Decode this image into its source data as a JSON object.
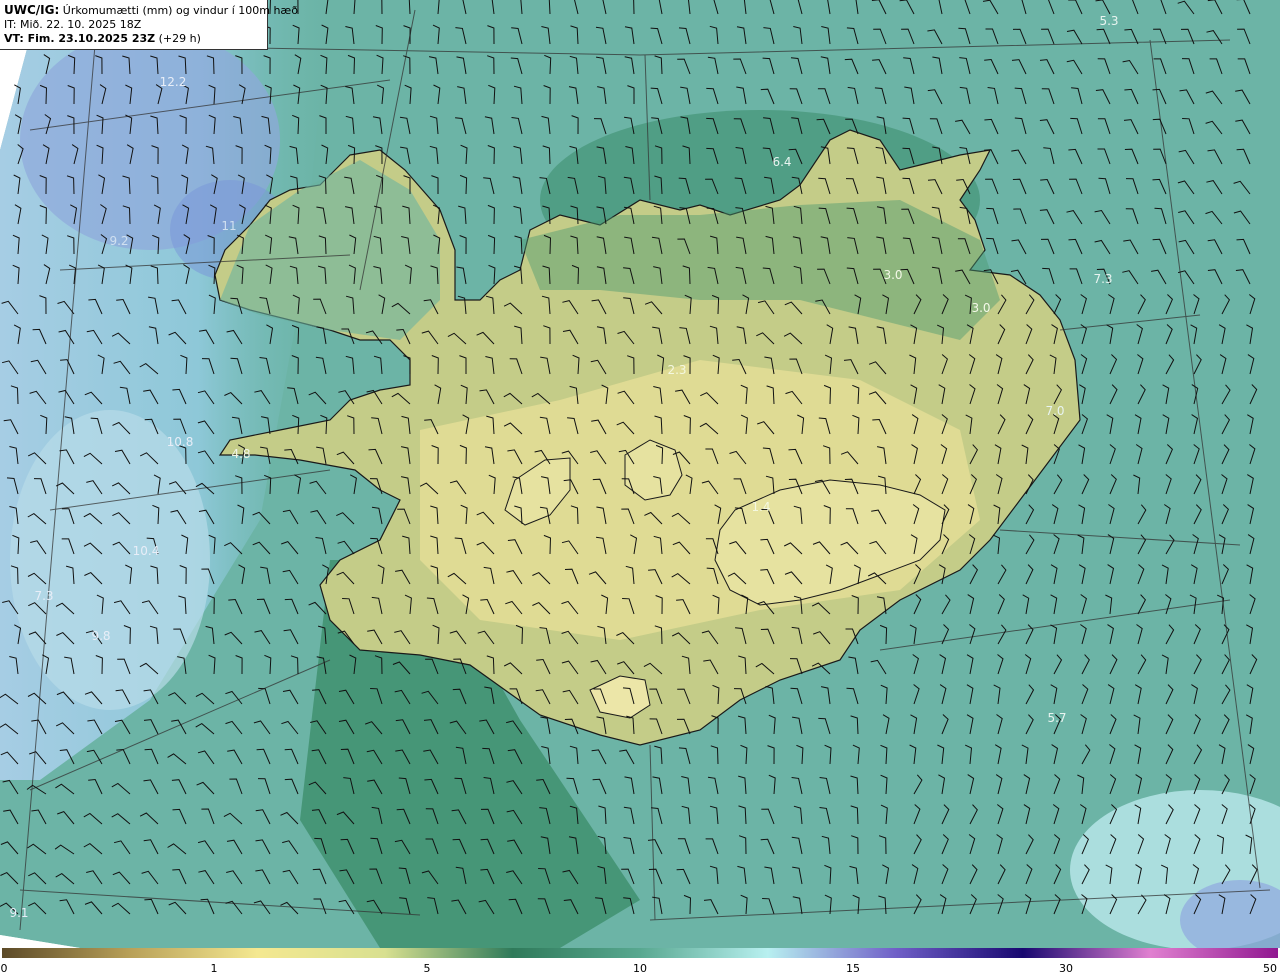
{
  "info": {
    "line1_bold": "UWC/IG:",
    "line1_rest": " Úrkomumætti (mm) og vindur í 100m hæð",
    "line2": "IT: Mið. 22. 10. 2025 18Z",
    "line3_bold": "VT: Fim. 23.10.2025 23Z",
    "line3_rest": " (+29 h)"
  },
  "values": [
    {
      "text": "12.2",
      "color": "#e8eef8"
    },
    {
      "text": "5.3",
      "color": "#e8f4f0"
    },
    {
      "text": "6.4",
      "color": "#e8f4f0"
    },
    {
      "text": "3.0",
      "color": "#f4f8e8"
    },
    {
      "text": "3.0",
      "color": "#f4f8e8"
    },
    {
      "text": "7.3",
      "color": "#e8f4f0"
    },
    {
      "text": "7.0",
      "color": "#e8f4f0"
    },
    {
      "text": "9.2",
      "color": "#d0e0f0"
    },
    {
      "text": "11",
      "color": "#d0e0f0"
    },
    {
      "text": "10.8",
      "color": "#e8eef8"
    },
    {
      "text": "4.8",
      "color": "#f0f4e8"
    },
    {
      "text": "10.4",
      "color": "#e8eef8"
    },
    {
      "text": "7.3",
      "color": "#e8eef8"
    },
    {
      "text": "9.8",
      "color": "#e8eef8"
    },
    {
      "text": "2.3",
      "color": "#f4f8e0"
    },
    {
      "text": "1.4",
      "color": "#f4f8e0"
    },
    {
      "text": "5.7",
      "color": "#e8f4f0"
    },
    {
      "text": "9.1",
      "color": "#e8eef8"
    }
  ],
  "colorbar": {
    "ticks": [
      "0",
      "1",
      "5",
      "10",
      "15",
      "30",
      "50"
    ],
    "colors": [
      "#5c4a28",
      "#b8a058",
      "#f4e890",
      "#d8e090",
      "#2f7a5a",
      "#58a890",
      "#b8f0f0",
      "#7060c8",
      "#180870",
      "#e080d0",
      "#901890"
    ]
  }
}
